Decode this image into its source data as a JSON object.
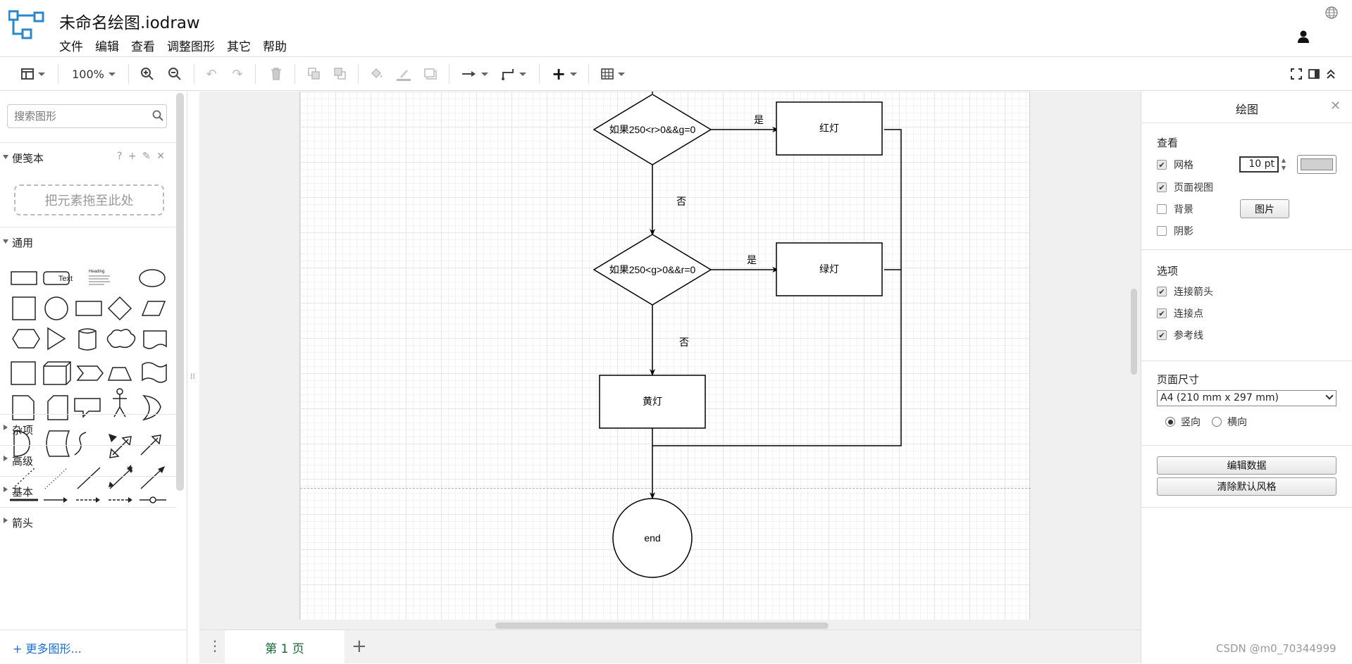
{
  "app": {
    "title": "未命名绘图.iodraw",
    "menu": [
      "文件",
      "编辑",
      "查看",
      "调整图形",
      "其它",
      "帮助"
    ],
    "watermark": "CSDN @m0_70344999"
  },
  "toolbar": {
    "zoom": "100%"
  },
  "sidebar": {
    "search_placeholder": "搜索图形",
    "scratchpad_label": "便笺本",
    "scratchpad_tools": "? + ✎ ✕",
    "scratchpad_drop": "把元素拖至此处",
    "general_label": "通用",
    "collapsed_sections": [
      "杂项",
      "高级",
      "基本",
      "箭头"
    ],
    "more_shapes": "+ 更多图形..."
  },
  "diagram": {
    "decision1": "如果250<r>0&&g=0",
    "decision2": "如果250<g>0&&r=0",
    "red_light": "红灯",
    "green_light": "绿灯",
    "yellow_light": "黄灯",
    "end": "end",
    "yes1": "是",
    "yes2": "是",
    "no1": "否",
    "no2": "否"
  },
  "pages": {
    "tab1": "第 1 页"
  },
  "format_panel": {
    "title": "绘图",
    "view_heading": "查看",
    "grid_label": "网格",
    "grid_size": "10 pt",
    "page_view_label": "页面视图",
    "background_label": "背景",
    "image_button": "图片",
    "shadow_label": "阴影",
    "options_heading": "选项",
    "connection_arrows": "连接箭头",
    "connection_points": "连接点",
    "guides": "参考线",
    "page_size_heading": "页面尺寸",
    "page_size_value": "A4 (210 mm x 297 mm)",
    "portrait": "竖向",
    "landscape": "横向",
    "edit_data_button": "编辑数据",
    "clear_style_button": "清除默认风格",
    "checked": {
      "grid": true,
      "page_view": true,
      "background": false,
      "shadow": false,
      "connection_arrows": true,
      "connection_points": true,
      "guides": true
    },
    "orientation": "portrait",
    "grid_color": "#d0d0d0"
  }
}
